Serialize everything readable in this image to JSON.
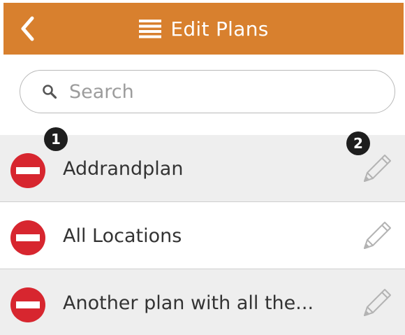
{
  "header": {
    "title": "Edit Plans",
    "back_icon": "chevron-left-icon",
    "menu_icon": "hamburger-menu-icon",
    "background": "#d8802e"
  },
  "search": {
    "placeholder": "Search",
    "value": "",
    "icon": "search-icon"
  },
  "plans": [
    {
      "name": "Addrandplan"
    },
    {
      "name": "All Locations"
    },
    {
      "name": "Another plan with all the..."
    }
  ],
  "callouts": [
    {
      "label": "1"
    },
    {
      "label": "2"
    }
  ],
  "colors": {
    "delete": "#d7262f",
    "row_shaded": "#eeeeee",
    "pencil": "#b3b3b3"
  }
}
